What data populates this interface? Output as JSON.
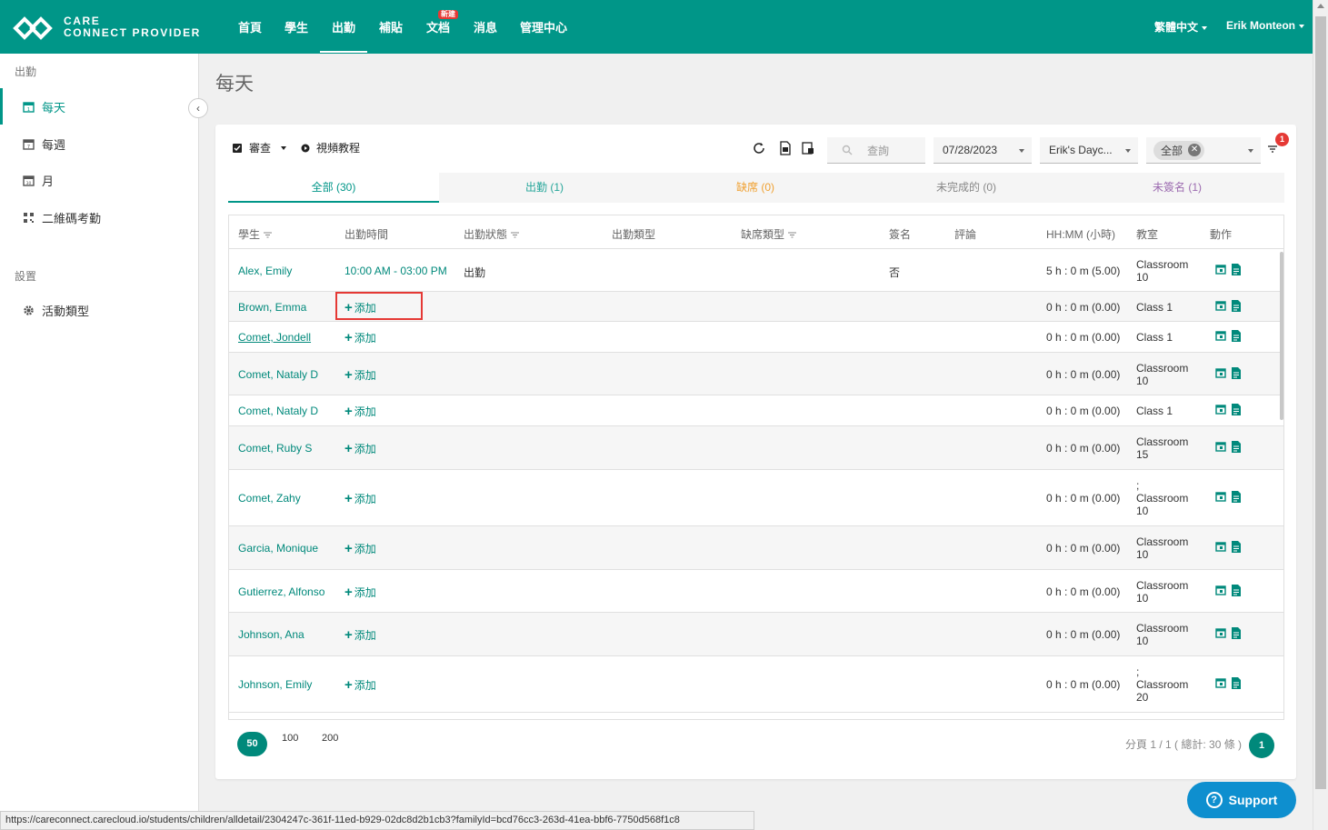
{
  "app": {
    "logo_line1": "CARE",
    "logo_line2": "CONNECT PROVIDER",
    "accent_color": "#009688"
  },
  "nav": {
    "items": [
      "首頁",
      "學生",
      "出勤",
      "補貼",
      "文档",
      "消息",
      "管理中心"
    ],
    "active": "出勤",
    "new_badge": "新建",
    "language": "繁體中文",
    "user": "Erik Monteon"
  },
  "sidebar": {
    "section1": "出勤",
    "items": [
      {
        "label": "每天",
        "icon": "calendar-day-icon",
        "active": true
      },
      {
        "label": "每週",
        "icon": "calendar-week-icon"
      },
      {
        "label": "月",
        "icon": "calendar-month-icon"
      },
      {
        "label": "二維碼考勤",
        "icon": "qr-code-icon"
      }
    ],
    "section2": "設置",
    "settings_items": [
      {
        "label": "活動類型",
        "icon": "gear-icon"
      }
    ]
  },
  "page": {
    "title": "每天"
  },
  "toolbar": {
    "review": "審查",
    "video": "視頻教程",
    "search_placeholder": "查詢",
    "date": "07/28/2023",
    "center": "Erik's Dayc...",
    "classroom_chip": "全部",
    "filter_count": "1"
  },
  "tabs": [
    {
      "label": "全部 (30)",
      "color": "#009688"
    },
    {
      "label": "出勤 (1)",
      "color": "#26a69a"
    },
    {
      "label": "缺席 (0)",
      "color": "#f0a030"
    },
    {
      "label": "未完成的 (0)",
      "color": "#888888"
    },
    {
      "label": "未簽名 (1)",
      "color": "#9c6bb0"
    }
  ],
  "table": {
    "columns": [
      "學生",
      "出勤時間",
      "出勤狀態",
      "出勤類型",
      "缺席類型",
      "簽名",
      "評論",
      "HH:MM (小時)",
      "教室",
      "動作"
    ],
    "add_label": "添加",
    "rows": [
      {
        "student": "Alex, Emily",
        "time": "10:00 AM - 03:00 PM",
        "status": "出勤",
        "signature": "否",
        "hours": "5 h : 0 m (5.00)",
        "room": [
          "Classroom",
          "10"
        ]
      },
      {
        "student": "Brown, Emma",
        "time": "",
        "status": "",
        "signature": "",
        "hours": "0 h : 0 m (0.00)",
        "room": [
          "Class 1"
        ]
      },
      {
        "student": "Comet, Jondell",
        "time": "",
        "status": "",
        "signature": "",
        "hours": "0 h : 0 m (0.00)",
        "room": [
          "Class 1"
        ]
      },
      {
        "student": "Comet, Nataly D",
        "time": "",
        "status": "",
        "signature": "",
        "hours": "0 h : 0 m (0.00)",
        "room": [
          "Classroom",
          "10"
        ]
      },
      {
        "student": "Comet, Nataly D",
        "time": "",
        "status": "",
        "signature": "",
        "hours": "0 h : 0 m (0.00)",
        "room": [
          "Class 1"
        ]
      },
      {
        "student": "Comet, Ruby S",
        "time": "",
        "status": "",
        "signature": "",
        "hours": "0 h : 0 m (0.00)",
        "room": [
          "Classroom",
          "15"
        ]
      },
      {
        "student": "Comet, Zahy",
        "time": "",
        "status": "",
        "signature": "",
        "hours": "0 h : 0 m (0.00)",
        "room": [
          ";",
          "Classroom",
          "10"
        ]
      },
      {
        "student": "Garcia, Monique",
        "time": "",
        "status": "",
        "signature": "",
        "hours": "0 h : 0 m (0.00)",
        "room": [
          "Classroom",
          "10"
        ]
      },
      {
        "student": "Gutierrez, Alfonso",
        "time": "",
        "status": "",
        "signature": "",
        "hours": "0 h : 0 m (0.00)",
        "room": [
          "Classroom",
          "10"
        ]
      },
      {
        "student": "Johnson, Ana",
        "time": "",
        "status": "",
        "signature": "",
        "hours": "0 h : 0 m (0.00)",
        "room": [
          "Classroom",
          "10"
        ]
      },
      {
        "student": "Johnson, Emily",
        "time": "",
        "status": "",
        "signature": "",
        "hours": "0 h : 0 m (0.00)",
        "room": [
          ";",
          "Classroom",
          "20"
        ]
      }
    ]
  },
  "pagination": {
    "sizes": [
      "50",
      "100",
      "200"
    ],
    "info": "分頁 1 / 1 ( 總計: 30 條 )",
    "current": "1"
  },
  "status_url": "https://careconnect.carecloud.io/students/children/alldetail/2304247c-361f-11ed-b929-02dc8d2b1cb3?familyId=bcd76cc3-263d-41ea-bbf6-7750d568f1c8",
  "support_label": "Support"
}
